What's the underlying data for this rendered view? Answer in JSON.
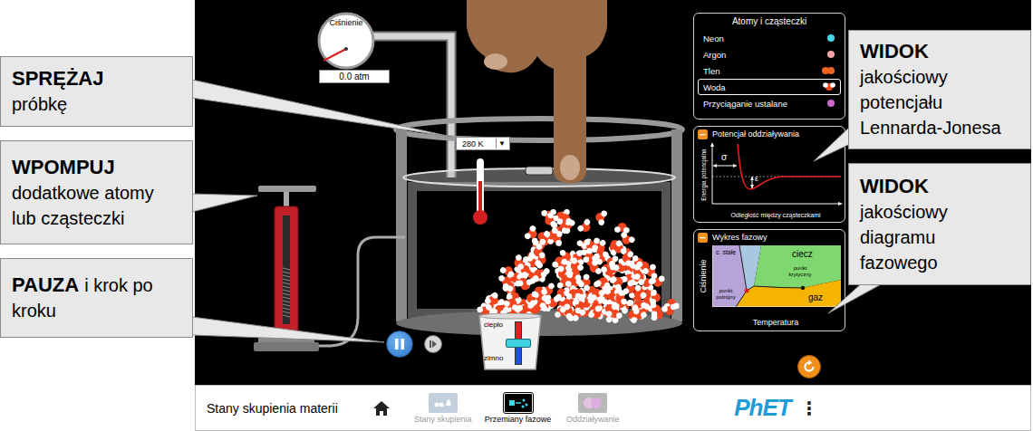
{
  "left_callouts": [
    {
      "lines": [
        [
          {
            "text": "SPRĘŻAJ",
            "bold": true
          }
        ],
        [
          {
            "text": "próbkę",
            "bold": false
          }
        ]
      ]
    },
    {
      "lines": [
        [
          {
            "text": "WPOMPUJ",
            "bold": true
          }
        ],
        [
          {
            "text": "dodatkowe atomy",
            "bold": false
          }
        ],
        [
          {
            "text": "lub cząsteczki",
            "bold": false
          }
        ]
      ]
    },
    {
      "lines": [
        [
          {
            "text": "PAUZA",
            "bold": true
          },
          {
            "text": "i krok po",
            "bold": false
          }
        ],
        [
          {
            "text": "kroku",
            "bold": false
          }
        ]
      ]
    }
  ],
  "right_callouts": [
    {
      "lines": [
        [
          {
            "text": "WIDOK",
            "bold": true
          }
        ],
        [
          {
            "text": "jakościowy",
            "bold": false
          }
        ],
        [
          {
            "text": "potencjału",
            "bold": false
          }
        ],
        [
          {
            "text": "Lennarda-Jonesa",
            "bold": false
          }
        ]
      ]
    },
    {
      "lines": [
        [
          {
            "text": "WIDOK",
            "bold": true
          }
        ],
        [
          {
            "text": "jakościowy",
            "bold": false
          }
        ],
        [
          {
            "text": "diagramu",
            "bold": false
          }
        ],
        [
          {
            "text": "fazowego",
            "bold": false
          }
        ]
      ]
    }
  ],
  "sim": {
    "pressure_gauge": {
      "label": "Ciśnienie",
      "reading": "0.0 atm"
    },
    "temperature": {
      "reading": "280 K",
      "dropdown": "▼"
    },
    "playback": {
      "playing": true
    },
    "heater": {
      "hot": "ciepło",
      "cold": "zimno",
      "level": 0.5
    },
    "atoms_panel": {
      "title": "Atomy i cząsteczki",
      "items": [
        {
          "label": "Neon",
          "selected": false,
          "kind": "atom",
          "color": "#3fd8e6"
        },
        {
          "label": "Argon",
          "selected": false,
          "kind": "atom",
          "color": "#f2a3a3"
        },
        {
          "label": "Tlen",
          "selected": false,
          "kind": "diatomic",
          "color": "#f0621f"
        },
        {
          "label": "Woda",
          "selected": true,
          "kind": "water",
          "color": "#f0451e"
        },
        {
          "label": "Przyciąganie ustalane",
          "selected": false,
          "kind": "atom",
          "color": "#cc66cc"
        }
      ]
    },
    "potential_panel": {
      "title": "Potencjał oddziaływania",
      "collapse": "−",
      "y_axis": "Energia potencjalna",
      "x_axis": "Odległość między cząsteczkami",
      "sigma": "σ",
      "epsilon": "ε"
    },
    "phase_panel": {
      "title": "Wykres fazowy",
      "collapse": "−",
      "y_axis": "Ciśnienie",
      "x_axis": "Temperatura",
      "solid": "c. stałe",
      "liquid": "ciecz",
      "gas": "gaz",
      "critical_point": "punkt krytyczny",
      "triple_point": "punkt potrójny"
    }
  },
  "nav": {
    "title": "Stany skupienia materii",
    "tabs": [
      {
        "label": "Stany skupienia",
        "selected": false,
        "kind": "states"
      },
      {
        "label": "Przemiany fazowe",
        "selected": true,
        "kind": "phase"
      },
      {
        "label": "Oddziaływanie",
        "selected": false,
        "kind": "interaction"
      }
    ],
    "logo": "PhET",
    "menu": "⋮"
  }
}
